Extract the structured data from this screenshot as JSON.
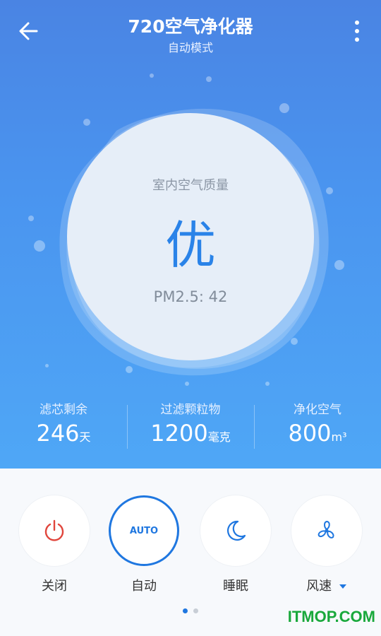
{
  "header": {
    "title": "720空气净化器",
    "subtitle": "自动模式"
  },
  "air_quality": {
    "label": "室内空气质量",
    "grade": "优",
    "pm25": "PM2.5: 42"
  },
  "stats": [
    {
      "label": "滤芯剩余",
      "value": "246",
      "unit": "天"
    },
    {
      "label": "过滤颗粒物",
      "value": "1200",
      "unit": "毫克"
    },
    {
      "label": "净化空气",
      "value": "800",
      "unit": "m³"
    }
  ],
  "controls": [
    {
      "label": "关闭",
      "icon": "power-icon"
    },
    {
      "label": "自动",
      "icon": "auto-text",
      "text": "AUTO"
    },
    {
      "label": "睡眠",
      "icon": "moon-icon"
    },
    {
      "label": "风速",
      "icon": "fan-icon"
    }
  ],
  "watermark": "ITMOP.COM",
  "colors": {
    "accent": "#1f77e0",
    "power": "#e0453c",
    "hero_top": "#4a84e3",
    "hero_bottom": "#4fa7f6"
  }
}
